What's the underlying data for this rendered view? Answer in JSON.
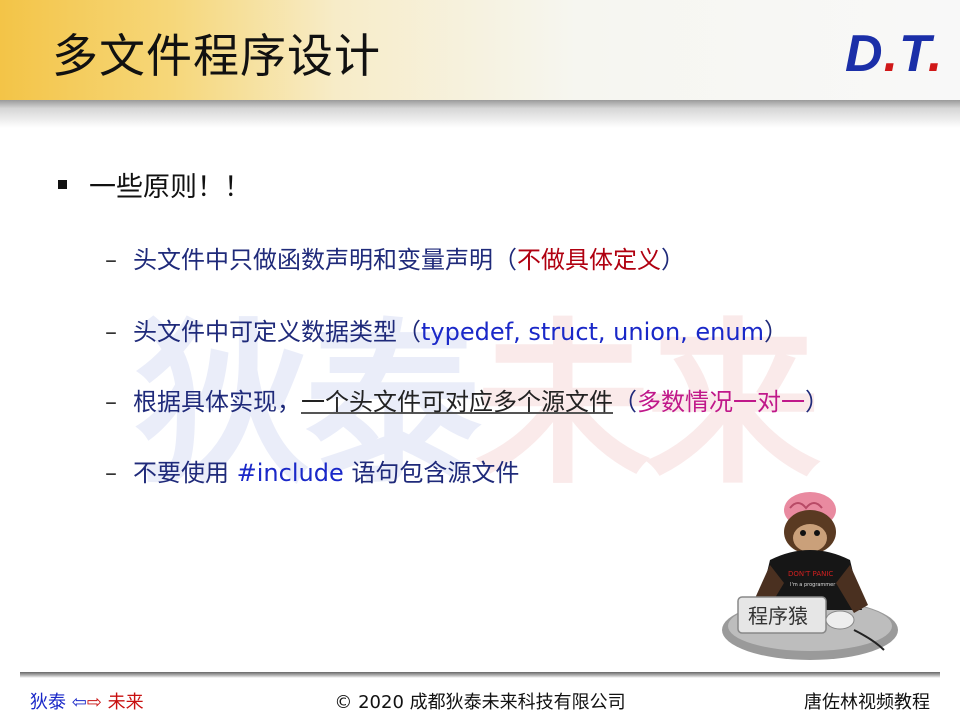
{
  "header": {
    "title": "多文件程序设计",
    "logo_main": "D",
    "logo_dot1": ".",
    "logo_t": "T",
    "logo_dot2": "."
  },
  "watermark": {
    "part_blue": "狄泰",
    "part_red": "未来"
  },
  "content": {
    "main_bullet": "一些原则！！",
    "items": [
      {
        "text": "头文件中只做函数声明和变量声明（",
        "highlight": "不做具体定义",
        "tail": "）"
      },
      {
        "text": "头文件中可定义数据类型（",
        "highlight": "typedef, struct, union, enum",
        "tail": "）"
      },
      {
        "text": "根据具体实现，",
        "underlined": "一个头文件可对应多个源文件",
        "paren_open": "（",
        "highlight": "多数情况一对一",
        "tail": "）"
      },
      {
        "text": "不要使用 ",
        "highlight": "#include",
        "tail": " 语句包含源文件"
      }
    ]
  },
  "mascot": {
    "shirt_line1": "DON'T PANIC",
    "shirt_line2": "I'm a programmer",
    "sign": "程序猿"
  },
  "footer": {
    "left_blue": "狄泰",
    "left_arrow_l": "⇦",
    "left_arrow_r": "⇨",
    "left_red": "未来",
    "center": "© 2020 成都狄泰未来科技有限公司",
    "right": "唐佐林视频教程"
  },
  "colors": {
    "title_bar": "#f3c447",
    "logo_blue": "#1b2fa8",
    "logo_red": "#d01818",
    "body_text": "#1f2a7a",
    "highlight_red": "#b00010",
    "highlight_blue": "#1a28c8",
    "highlight_magenta": "#c0188a"
  }
}
